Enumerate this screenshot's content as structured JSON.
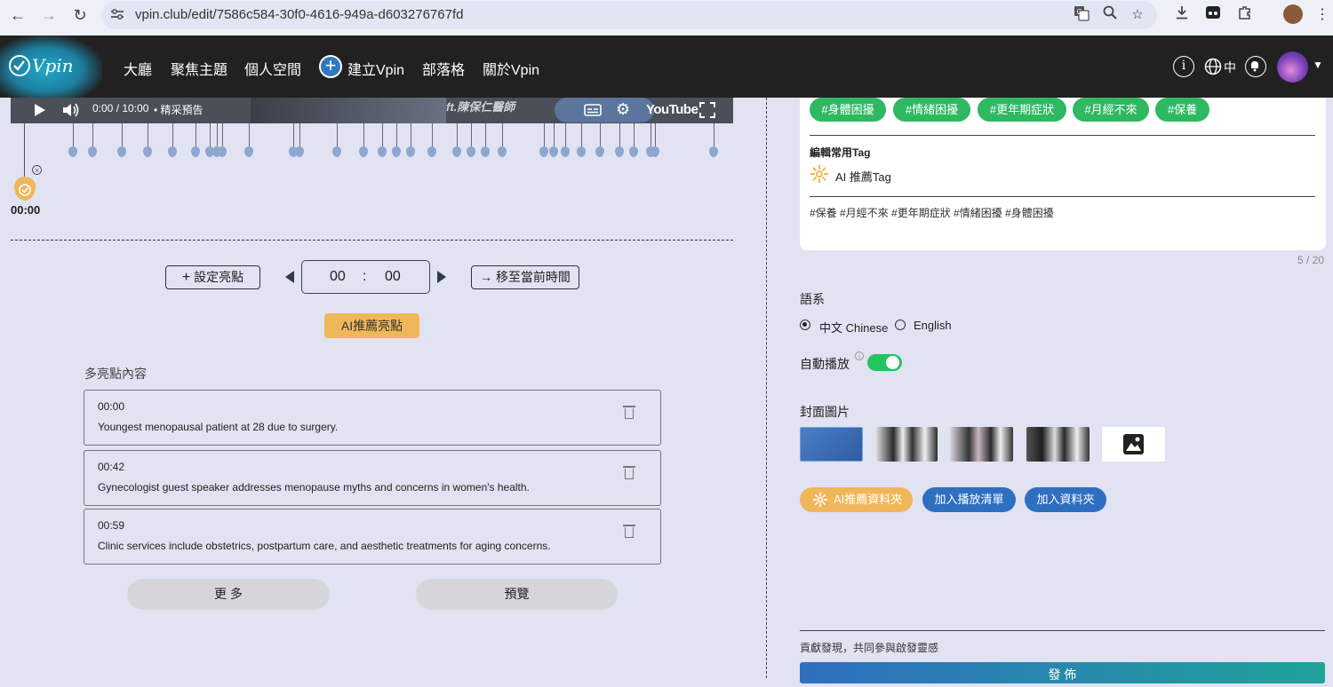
{
  "browser": {
    "url": "vpin.club/edit/7586c584-30f0-4616-949a-d603276767fd"
  },
  "header": {
    "logo_text": "Vpin",
    "nav": [
      "大廳",
      "聚焦主題",
      "個人空間",
      "建立Vpin",
      "部落格",
      "關於Vpin"
    ],
    "lang": "中"
  },
  "video": {
    "time": "0:00 / 10:00",
    "chapter": "• 精采預告",
    "youtube_label": "YouTube",
    "overlay_text": "ft.陳保仁醫師"
  },
  "timeline": {
    "current_time": "00:00"
  },
  "controls": {
    "set_highlight": "設定亮點",
    "minutes": "00",
    "colon": ":",
    "seconds": "00",
    "move_to_current": "移至當前時間",
    "ai_recommend": "AI推薦亮點"
  },
  "highlights": {
    "section_label": "多亮點內容",
    "items": [
      {
        "time": "00:00",
        "text": "Youngest menopausal patient at 28 due to surgery."
      },
      {
        "time": "00:42",
        "text": "Gynecologist guest speaker addresses menopause myths and concerns in women's health."
      },
      {
        "time": "00:59",
        "text": "Clinic services include obstetrics, postpartum care, and aesthetic treatments for aging concerns."
      }
    ],
    "more_button": "更 多",
    "preview_button": "預覽"
  },
  "tags": {
    "chips": [
      "#身體困擾",
      "#情緒困擾",
      "#更年期症狀",
      "#月經不來",
      "#保養"
    ],
    "edit_label": "編輯常用Tag",
    "ai_tag_label": "AI 推薦Tag",
    "tag_text": "#保養 #月經不來 #更年期症狀 #情緒困擾 #身體困擾",
    "count": "5 / 20"
  },
  "language": {
    "label": "語系",
    "options": [
      "中文 Chinese",
      "English"
    ],
    "selected": "中文 Chinese"
  },
  "autoplay": {
    "label": "自動播放",
    "enabled": true
  },
  "cover": {
    "label": "封面圖片"
  },
  "actions": {
    "ai_folder": "AI推薦資料夾",
    "add_playlist": "加入播放清單",
    "add_folder": "加入資料夾"
  },
  "footer": {
    "contribute_text": "貢獻發現，共同參與啟發靈感",
    "publish": "發 佈"
  },
  "colors": {
    "tag_green": "#2eb862",
    "ai_orange": "#efb75a",
    "action_blue": "#2f6fc0",
    "header_bg": "#212121",
    "page_bg": "#e1e2f2"
  }
}
